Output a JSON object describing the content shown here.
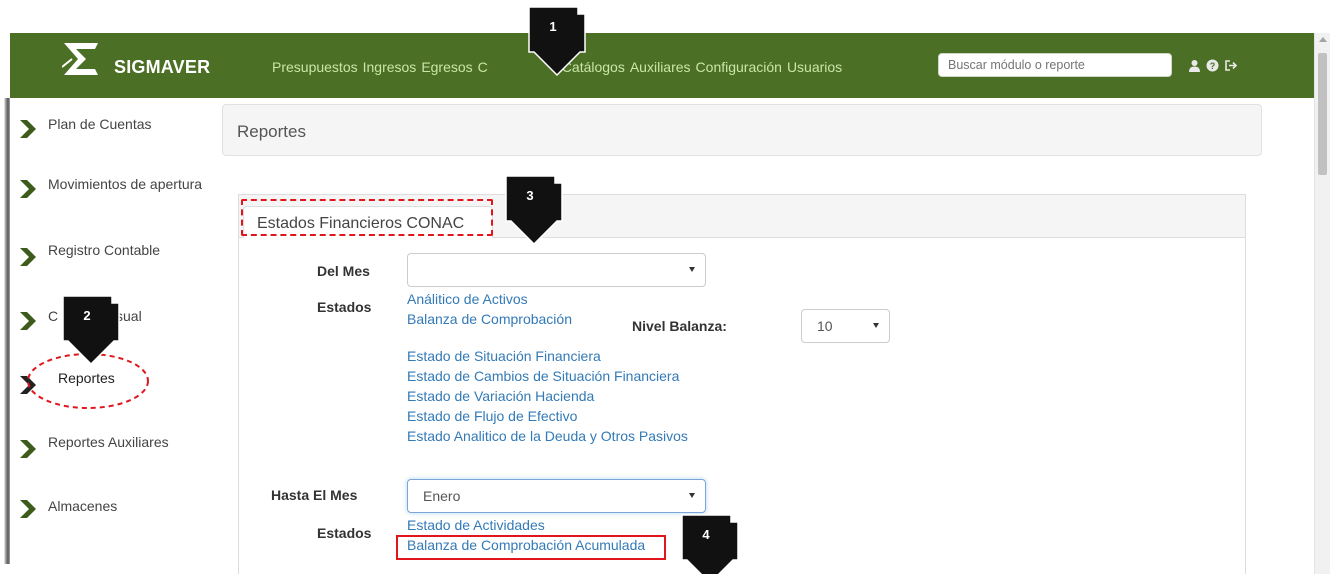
{
  "nav": {
    "brand": "SIGMAVER",
    "links": [
      "Presupuestos",
      "Ingresos",
      "Egresos",
      "C",
      "Catálogos",
      "Auxiliares",
      "Configuración",
      "Usuarios"
    ],
    "search_placeholder": "Buscar módulo o reporte",
    "icons": [
      "user-icon",
      "question-icon",
      "logout-icon"
    ]
  },
  "sidebar": {
    "items": [
      {
        "label": "Plan de Cuentas"
      },
      {
        "label": "Movimientos de apertura"
      },
      {
        "label": "Registro Contable"
      },
      {
        "label": "C",
        "label_end": "sual"
      },
      {
        "label": "Reportes"
      },
      {
        "label": "Reportes Auxiliares"
      },
      {
        "label": "Almacenes"
      }
    ]
  },
  "header": {
    "title": "Reportes"
  },
  "panel": {
    "tab_label": "Estados Financieros CONAC",
    "del_mes": {
      "label": "Del Mes",
      "value": ""
    },
    "estados1": {
      "label": "Estados",
      "links": [
        "Análitico de Activos",
        "Balanza de Comprobación",
        "Estado de Situación Financiera",
        "Estado de Cambios de Situación Financiera",
        "Estado de Variación Hacienda",
        "Estado de Flujo de Efectivo",
        "Estado Analitico de la Deuda y Otros Pasivos"
      ]
    },
    "nivel_balanza": {
      "label": "Nivel Balanza:",
      "value": "10"
    },
    "hasta_el_mes": {
      "label": "Hasta El Mes",
      "value": "Enero"
    },
    "estados2": {
      "label": "Estados",
      "links": [
        "Estado de Actividades",
        "Balanza de Comprobación Acumulada"
      ]
    }
  },
  "annotations": {
    "steps": [
      "1",
      "2",
      "3",
      "4"
    ],
    "highlight_color": "#e0161c"
  },
  "colors": {
    "navbar": "#4b6f24",
    "sidebar_chevron": "#3d5c1c",
    "link": "#337ab7"
  }
}
